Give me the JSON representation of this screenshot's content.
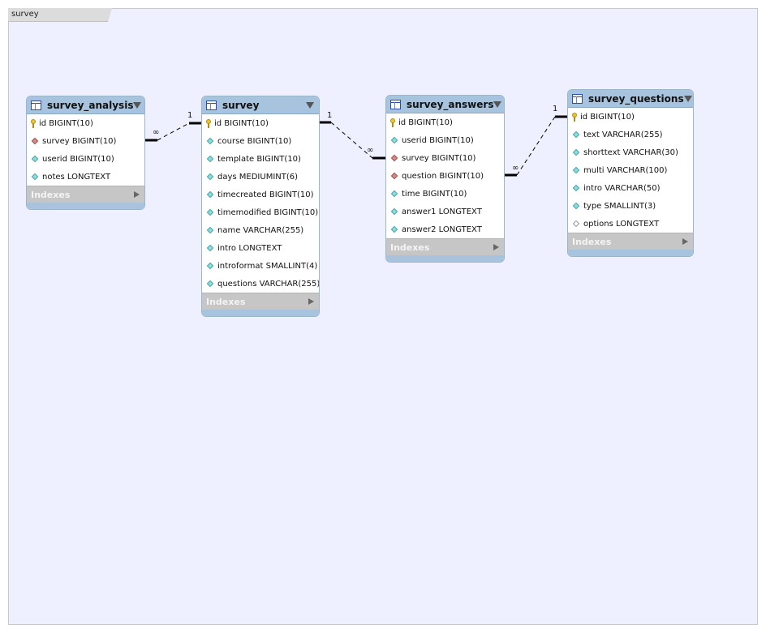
{
  "layer": {
    "title": "survey"
  },
  "entities": {
    "survey_analysis": {
      "title": "survey_analysis",
      "columns": [
        {
          "name": "id BIGINT(10)",
          "icon": "primary-key-icon"
        },
        {
          "name": "survey BIGINT(10)",
          "icon": "foreign-key-icon"
        },
        {
          "name": "userid BIGINT(10)",
          "icon": "column-icon"
        },
        {
          "name": "notes LONGTEXT",
          "icon": "column-icon"
        }
      ],
      "indexes_label": "Indexes"
    },
    "survey": {
      "title": "survey",
      "columns": [
        {
          "name": "id BIGINT(10)",
          "icon": "primary-key-icon"
        },
        {
          "name": "course BIGINT(10)",
          "icon": "column-icon"
        },
        {
          "name": "template BIGINT(10)",
          "icon": "column-icon"
        },
        {
          "name": "days MEDIUMINT(6)",
          "icon": "column-icon"
        },
        {
          "name": "timecreated BIGINT(10)",
          "icon": "column-icon"
        },
        {
          "name": "timemodified BIGINT(10)",
          "icon": "column-icon"
        },
        {
          "name": "name VARCHAR(255)",
          "icon": "column-icon"
        },
        {
          "name": "intro LONGTEXT",
          "icon": "column-icon"
        },
        {
          "name": "introformat SMALLINT(4)",
          "icon": "column-icon"
        },
        {
          "name": "questions VARCHAR(255)",
          "icon": "column-icon"
        }
      ],
      "indexes_label": "Indexes"
    },
    "survey_answers": {
      "title": "survey_answers",
      "columns": [
        {
          "name": "id BIGINT(10)",
          "icon": "primary-key-icon"
        },
        {
          "name": "userid BIGINT(10)",
          "icon": "column-icon"
        },
        {
          "name": "survey BIGINT(10)",
          "icon": "foreign-key-icon"
        },
        {
          "name": "question BIGINT(10)",
          "icon": "foreign-key-icon"
        },
        {
          "name": "time BIGINT(10)",
          "icon": "column-icon"
        },
        {
          "name": "answer1 LONGTEXT",
          "icon": "column-icon"
        },
        {
          "name": "answer2 LONGTEXT",
          "icon": "column-icon"
        }
      ],
      "indexes_label": "Indexes"
    },
    "survey_questions": {
      "title": "survey_questions",
      "columns": [
        {
          "name": "id BIGINT(10)",
          "icon": "primary-key-icon"
        },
        {
          "name": "text VARCHAR(255)",
          "icon": "column-icon"
        },
        {
          "name": "shorttext VARCHAR(30)",
          "icon": "column-icon"
        },
        {
          "name": "multi VARCHAR(100)",
          "icon": "column-icon"
        },
        {
          "name": "intro VARCHAR(50)",
          "icon": "column-icon"
        },
        {
          "name": "type SMALLINT(3)",
          "icon": "column-icon"
        },
        {
          "name": "options LONGTEXT",
          "icon": "nullable-column-icon"
        }
      ],
      "indexes_label": "Indexes"
    }
  },
  "relationships": {
    "analysis_survey": {
      "many_label": "∞",
      "one_label": "1"
    },
    "survey_answers": {
      "one_label": "1",
      "many_label": "∞"
    },
    "answers_questions": {
      "many_label": "∞",
      "one_label": "1"
    }
  }
}
